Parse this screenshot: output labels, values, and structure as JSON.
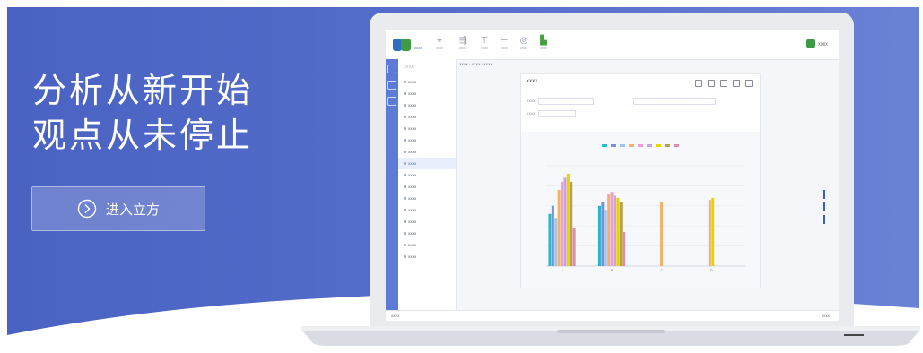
{
  "hero": {
    "line1": "分析从新开始",
    "line2": "观点从未停止",
    "cta_label": "进入立方"
  },
  "colors": {
    "banner": "#5168c8",
    "accent": "#3d9b45"
  },
  "app": {
    "logo_text": "XXXX",
    "toolbar": [
      "XXXX",
      "XXXX",
      "XXXX",
      "XXXX",
      "XXXX",
      "XXXX"
    ],
    "user": "XXXX",
    "breadcrumb": "XXXX › XXXX › XXXX",
    "sidebar_head": "XXXX",
    "sidebar_items": [
      "XXXX",
      "XXXX",
      "XXXX",
      "XXXX",
      "XXXX",
      "XXXX",
      "XXXX",
      "XXXX",
      "XXXX",
      "XXXX",
      "XXXX",
      "XXXX",
      "XXXX",
      "XXXX",
      "XXXX",
      "XXXX"
    ],
    "panel_title": "XXXX",
    "filter1": "XXXX",
    "filter2": "XXXX",
    "status_left": "XXXX",
    "status_right": "XXXX"
  },
  "chart_data": {
    "type": "bar",
    "categories": [
      "A",
      "B",
      "C",
      "D"
    ],
    "series": [
      {
        "color": "#29b7c8",
        "values": [
          130,
          150,
          0,
          0
        ]
      },
      {
        "color": "#7a8fe0",
        "values": [
          150,
          160,
          0,
          0
        ]
      },
      {
        "color": "#9fc6ee",
        "values": [
          120,
          140,
          0,
          0
        ]
      },
      {
        "color": "#f6b06a",
        "values": [
          190,
          180,
          160,
          165
        ]
      },
      {
        "color": "#e6a0d2",
        "values": [
          210,
          185,
          0,
          0
        ]
      },
      {
        "color": "#c9a0e6",
        "values": [
          220,
          175,
          0,
          0
        ]
      },
      {
        "color": "#e8d200",
        "values": [
          230,
          170,
          0,
          170
        ]
      },
      {
        "color": "#b8a04e",
        "values": [
          210,
          160,
          0,
          0
        ]
      },
      {
        "color": "#e08ab0",
        "values": [
          95,
          85,
          0,
          0
        ]
      }
    ],
    "ylim": [
      0,
      250
    ],
    "legend_position": "top",
    "grid": true
  }
}
